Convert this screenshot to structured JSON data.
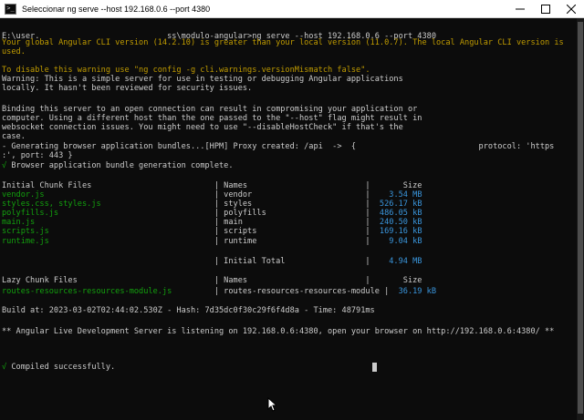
{
  "window": {
    "title": "Seleccionar ng serve  --host 192.168.0.6  --port 4380",
    "icon": "terminal-icon",
    "controls": [
      "minimize-icon",
      "maximize-icon",
      "close-icon"
    ]
  },
  "terminal": {
    "lines": [
      {
        "text": "E:\\user.                           ss\\modulo-angular>ng serve --host 192.168.0.6 --port 4380",
        "style": "w"
      },
      {
        "text": "Your global Angular CLI version (14.2.10) is greater than your local version (11.0.7). The local Angular CLI version is",
        "style": "y"
      },
      {
        "text": "used.",
        "style": "y"
      },
      {
        "text": "",
        "style": "w"
      },
      {
        "text": "To disable this warning use \"ng config -g cli.warnings.versionMismatch false\".",
        "style": "y"
      },
      {
        "text": "Warning: This is a simple server for use in testing or debugging Angular applications",
        "style": "w"
      },
      {
        "text": "locally. It hasn't been reviewed for security issues.",
        "style": "w"
      },
      {
        "text": "",
        "style": "w"
      },
      {
        "text": "Binding this server to an open connection can result in compromising your application or",
        "style": "w"
      },
      {
        "text": "computer. Using a different host than the one passed to the \"--host\" flag might result in",
        "style": "w"
      },
      {
        "text": "websocket connection issues. You might need to use \"--disableHostCheck\" if that's the",
        "style": "w"
      },
      {
        "text": "case.",
        "style": "w"
      },
      {
        "text": "- Generating browser application bundles...[HPM] Proxy created: /api  ->  {                          protocol: 'https",
        "style": "w"
      },
      {
        "text": ":', port: 443 }",
        "style": "w"
      },
      {
        "text": "√ Browser application bundle generation complete.",
        "style": "w"
      },
      {
        "text": "",
        "style": "w"
      },
      {
        "text": "Initial Chunk Files                          | Names                         |       Size",
        "style": "w"
      },
      {
        "text": "vendor.js                                    | vendor                        |    3.54 MB",
        "style": "w"
      },
      {
        "text": "styles.css, styles.js                        | styles                        |  526.17 kB",
        "style": "w"
      },
      {
        "text": "polyfills.js                                 | polyfills                     |  486.05 kB",
        "style": "w"
      },
      {
        "text": "main.js                                      | main                          |  240.50 kB",
        "style": "w"
      },
      {
        "text": "scripts.js                                   | scripts                       |  169.16 kB",
        "style": "w"
      },
      {
        "text": "runtime.js                                   | runtime                       |    9.04 kB",
        "style": "w"
      },
      {
        "text": "",
        "style": "w"
      },
      {
        "text": "                                             | Initial Total                 |    4.94 MB",
        "style": "w"
      },
      {
        "text": "",
        "style": "w"
      },
      {
        "text": "Lazy Chunk Files                             | Names                         |       Size",
        "style": "w"
      },
      {
        "text": "routes-resources-resources-module.js         | routes-resources-resources-module |  36.19 kB",
        "style": "w"
      },
      {
        "text": "",
        "style": "w"
      },
      {
        "text": "Build at: 2023-03-02T02:44:02.530Z - Hash: 7d35dc0f30c29f6f4d8a - Time: 48791ms",
        "style": "w"
      },
      {
        "text": "",
        "style": "w"
      },
      {
        "text": "** Angular Live Development Server is listening on 192.168.0.6:4380, open your browser on http://192.168.0.6:4380/ **",
        "style": "w"
      },
      {
        "text": "",
        "style": "w"
      },
      {
        "text": "",
        "style": "w"
      },
      {
        "text": "√ Compiled successfully.",
        "style": "w"
      }
    ]
  },
  "colors": {
    "background": "#0c0c0c",
    "text": "#cccccc",
    "warning": "#c19c00",
    "success": "#13a10e",
    "size": "#3a96dd"
  }
}
